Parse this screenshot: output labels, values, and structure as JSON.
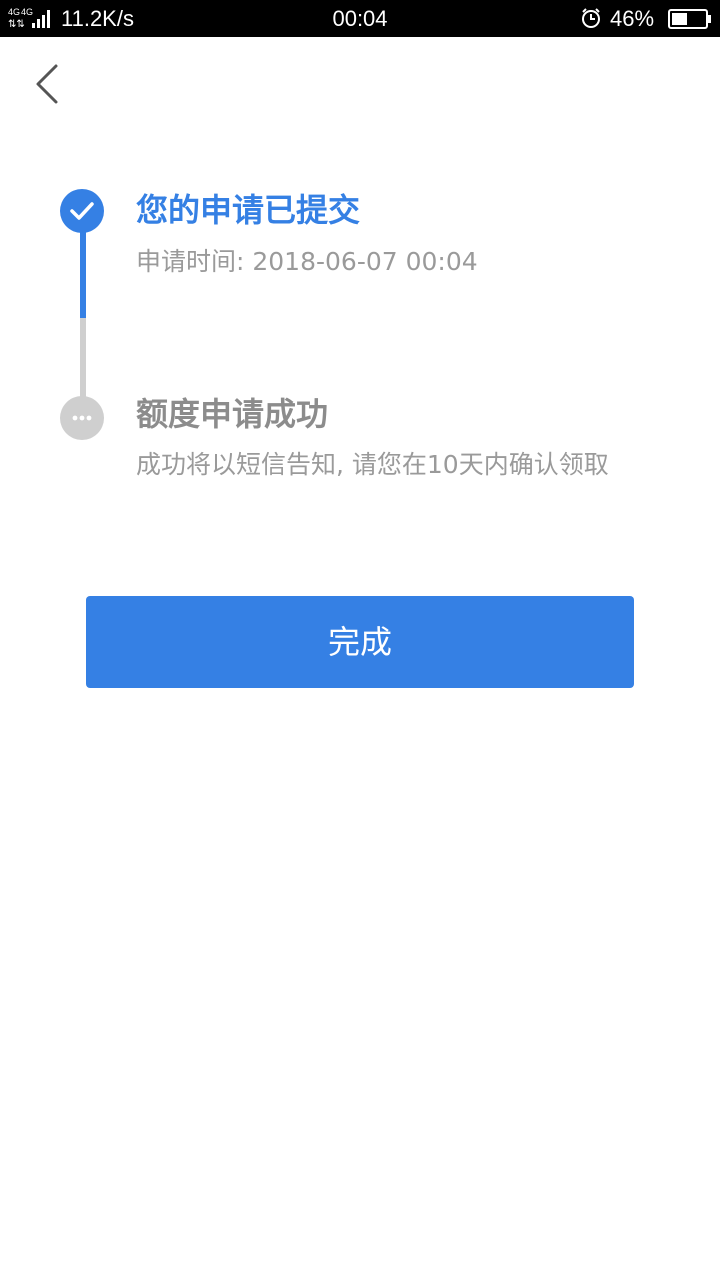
{
  "status_bar": {
    "network": "4G 4G",
    "speed": "11.2K/s",
    "time": "00:04",
    "battery_percent": "46%",
    "battery_level": 0.46,
    "icons": [
      "signal-icon",
      "alarm-icon",
      "battery-icon"
    ]
  },
  "nav": {
    "back_icon": "chevron-left-icon"
  },
  "steps": [
    {
      "title": "您的申请已提交",
      "subtitle": "申请时间: 2018-06-07 00:04",
      "status": "done",
      "icon": "check-icon"
    },
    {
      "title": "额度申请成功",
      "subtitle": "成功将以短信告知, 请您在10天内确认领取",
      "status": "pending",
      "icon": "more-dots-icon"
    }
  ],
  "actions": {
    "done_label": "完成"
  },
  "colors": {
    "accent": "#3580e4",
    "pending": "#cfcfcf",
    "muted_text": "#9a9a9a"
  }
}
